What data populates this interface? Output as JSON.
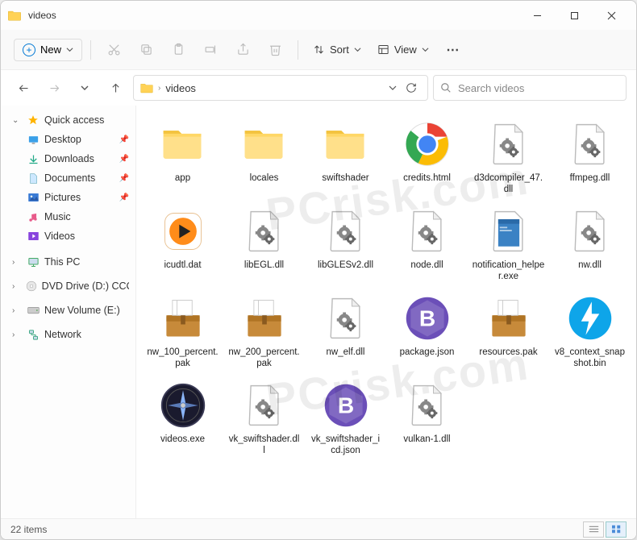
{
  "titlebar": {
    "title": "videos"
  },
  "toolbar": {
    "new_label": "New",
    "sort_label": "Sort",
    "view_label": "View"
  },
  "breadcrumb": [
    "videos"
  ],
  "search": {
    "placeholder": "Search videos"
  },
  "sidebar": {
    "quick_access": "Quick access",
    "items": [
      {
        "label": "Desktop",
        "icon": "desktop",
        "pinned": true
      },
      {
        "label": "Downloads",
        "icon": "downloads",
        "pinned": true
      },
      {
        "label": "Documents",
        "icon": "documents",
        "pinned": true
      },
      {
        "label": "Pictures",
        "icon": "pictures",
        "pinned": true
      },
      {
        "label": "Music",
        "icon": "music",
        "pinned": false
      },
      {
        "label": "Videos",
        "icon": "videos",
        "pinned": false
      }
    ],
    "this_pc": "This PC",
    "dvd": "DVD Drive (D:) CCCC",
    "volume": "New Volume (E:)",
    "network": "Network"
  },
  "files": [
    {
      "name": "app",
      "type": "folder"
    },
    {
      "name": "locales",
      "type": "folder"
    },
    {
      "name": "swiftshader",
      "type": "folder"
    },
    {
      "name": "credits.html",
      "type": "chrome"
    },
    {
      "name": "d3dcompiler_47.dll",
      "type": "dll"
    },
    {
      "name": "ffmpeg.dll",
      "type": "dll"
    },
    {
      "name": "icudtl.dat",
      "type": "play"
    },
    {
      "name": "libEGL.dll",
      "type": "dll"
    },
    {
      "name": "libGLESv2.dll",
      "type": "dll"
    },
    {
      "name": "node.dll",
      "type": "dll"
    },
    {
      "name": "notification_helper.exe",
      "type": "notif"
    },
    {
      "name": "nw.dll",
      "type": "dll"
    },
    {
      "name": "nw_100_percent.pak",
      "type": "pak"
    },
    {
      "name": "nw_200_percent.pak",
      "type": "pak"
    },
    {
      "name": "nw_elf.dll",
      "type": "dll"
    },
    {
      "name": "package.json",
      "type": "json"
    },
    {
      "name": "resources.pak",
      "type": "pak"
    },
    {
      "name": "v8_context_snapshot.bin",
      "type": "bolt"
    },
    {
      "name": "videos.exe",
      "type": "compass"
    },
    {
      "name": "vk_swiftshader.dll",
      "type": "dll"
    },
    {
      "name": "vk_swiftshader_icd.json",
      "type": "json"
    },
    {
      "name": "vulkan-1.dll",
      "type": "dll"
    }
  ],
  "statusbar": {
    "count": "22 items"
  }
}
